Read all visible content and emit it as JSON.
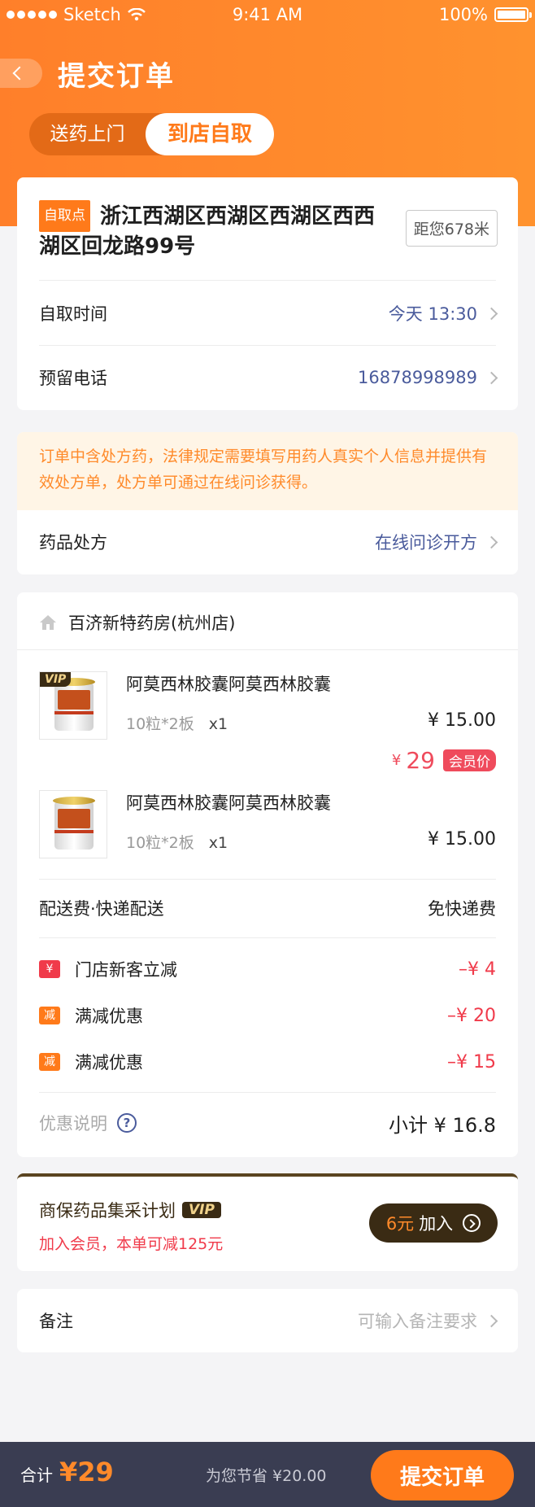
{
  "status_bar": {
    "carrier": "Sketch",
    "time": "9:41 AM",
    "battery": "100%"
  },
  "header": {
    "title": "提交订单",
    "tabs": [
      "送药上门",
      "到店自取"
    ],
    "active_tab": 1
  },
  "pickup": {
    "tag": "自取点",
    "address": "浙江西湖区西湖区西湖区西西湖区回龙路99号",
    "distance": "距您678米",
    "time_label": "自取时间",
    "time_value": "今天 13:30",
    "phone_label": "预留电话",
    "phone_value": "16878998989"
  },
  "prescription": {
    "notice": "订单中含处方药，法律规定需要填写用药人真实个人信息并提供有效处方单，处方单可通过在线问诊获得。",
    "label": "药品处方",
    "value": "在线问诊开方"
  },
  "store": {
    "name": "百济新特药房(杭州店)",
    "products": [
      {
        "vip": "VIP",
        "name": "阿莫西林胶囊阿莫西林胶囊",
        "spec": "10粒*2板",
        "qty": "x1",
        "price": "¥ 15.00",
        "member_price_symbol": "¥",
        "member_price": "29",
        "member_tag": "会员价"
      },
      {
        "name": "阿莫西林胶囊阿莫西林胶囊",
        "spec": "10粒*2板",
        "qty": "x1",
        "price": "¥ 15.00"
      }
    ],
    "shipping_label": "配送费·快递配送",
    "shipping_value": "免快递费",
    "discounts": [
      {
        "icon": "¥",
        "color": "#f03a4a",
        "label": "门店新客立减",
        "amount": "–¥ 4"
      },
      {
        "icon": "减",
        "color": "#ff7a1a",
        "label": "满减优惠",
        "amount": "–¥ 20"
      },
      {
        "icon": "减",
        "color": "#ff7a1a",
        "label": "满减优惠",
        "amount": "–¥ 15"
      }
    ],
    "discount_info_label": "优惠说明",
    "subtotal": "小计 ¥ 16.8"
  },
  "vip_plan": {
    "title": "商保药品集采计划",
    "logo": "VIP",
    "subtitle": "加入会员，本单可减125元",
    "btn_price": "6元",
    "btn_label": "加入"
  },
  "remark": {
    "label": "备注",
    "placeholder": "可输入备注要求"
  },
  "footer": {
    "total_label": "合计",
    "total": "¥29",
    "saved": "为您节省 ¥20.00",
    "submit": "提交订单"
  },
  "colors": {
    "accent": "#ff7a1a",
    "link": "#4a5b9c",
    "discount": "#f03a4a",
    "footer_bg": "#3a3d52"
  }
}
